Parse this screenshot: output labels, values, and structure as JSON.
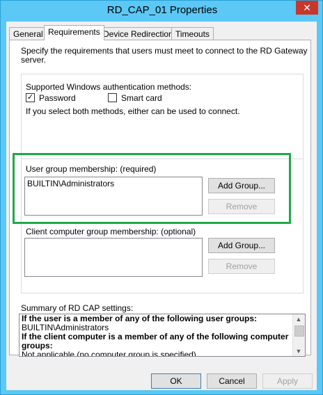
{
  "window": {
    "title": "RD_CAP_01 Properties",
    "close_glyph": "✕"
  },
  "tabs": [
    {
      "label": "General"
    },
    {
      "label": "Requirements"
    },
    {
      "label": "Device Redirection"
    },
    {
      "label": "Timeouts"
    }
  ],
  "requirements": {
    "intro": "Specify the requirements that users must meet to connect to the RD Gateway server.",
    "intro_line1": "Specify the requirements that users must meet to connect to the RD Gateway",
    "intro_line2": "server.",
    "auth_label": "Supported Windows authentication methods:",
    "password_label": "Password",
    "password_checked": true,
    "smartcard_label": "Smart card",
    "smartcard_checked": false,
    "both_methods_note": "If you select both methods, either can be used to connect.",
    "user_group_label": "User group membership: (required)",
    "user_groups": [
      "BUILTIN\\Administrators"
    ],
    "add_group_label": "Add Group...",
    "remove_label": "Remove",
    "client_group_label": "Client computer group membership: (optional)",
    "client_groups": [],
    "summary_label": "Summary of RD CAP settings:",
    "summary_lines": [
      {
        "text": "If the user is a member of any of the following user groups:",
        "bold": true
      },
      {
        "text": "BUILTIN\\Administrators",
        "bold": false
      },
      {
        "text": "If the client computer is a member of any of the following computer",
        "bold": true
      },
      {
        "text": "groups:",
        "bold": true
      },
      {
        "text": "Not applicable (no computer group is specified)",
        "bold": false
      }
    ]
  },
  "footer": {
    "ok_label": "OK",
    "cancel_label": "Cancel",
    "apply_label": "Apply"
  },
  "colors": {
    "highlight_box": "#1fa84a",
    "title_bar": "#5bc8f5"
  }
}
